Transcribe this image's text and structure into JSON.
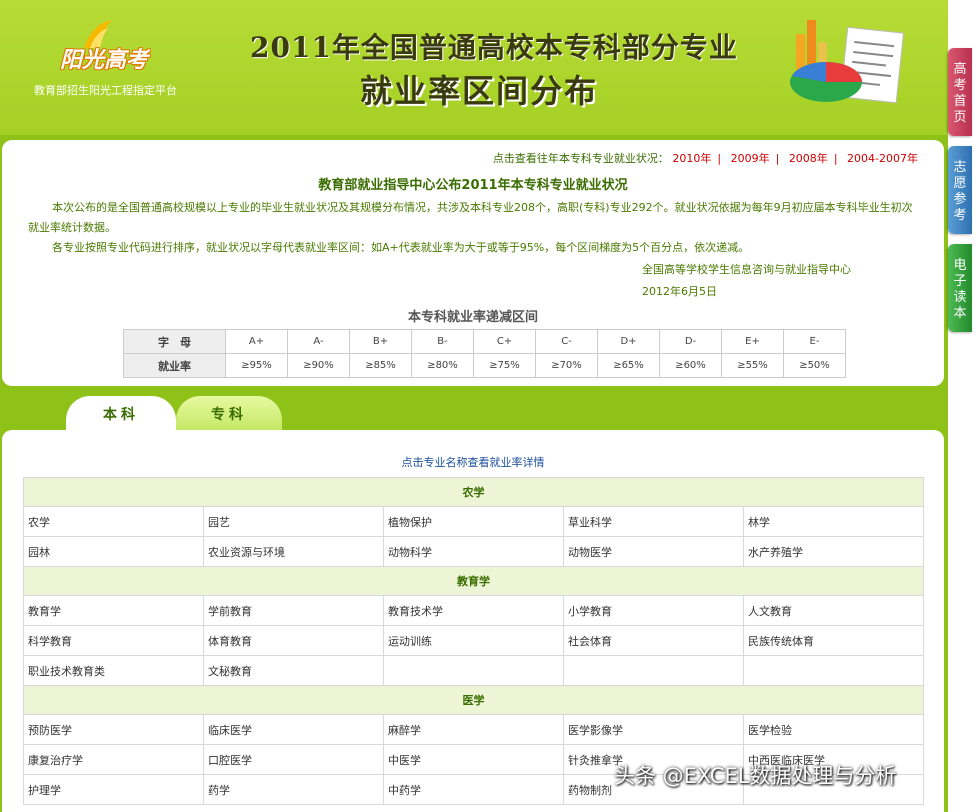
{
  "header": {
    "logo_text": "阳光高考",
    "logo_sub": "教育部招生阳光工程指定平台",
    "title_line1": "2011年全国普通高校本专科部分专业",
    "title_line2": "就业率区间分布"
  },
  "intro": {
    "past_label": "点击查看往年本专科专业就业状况：",
    "past_links": [
      "2010年",
      "2009年",
      "2008年",
      "2004-2007年"
    ],
    "title": "教育部就业指导中心公布2011年本专科专业就业状况",
    "para1": "本次公布的是全国普通高校规模以上专业的毕业生就业状况及其规模分布情况，共涉及本科专业208个，高职(专科)专业292个。就业状况依据为每年9月初应届本专科毕业生初次就业率统计数据。",
    "para2": "各专业按照专业代码进行排序，就业状况以字母代表就业率区间：如A+代表就业率为大于或等于95%，每个区间梯度为5个百分点，依次递减。",
    "sign_org": "全国高等学校学生信息咨询与就业指导中心",
    "sign_date": "2012年6月5日",
    "scale_title": "本专科就业率递减区间",
    "scale_head_letter": "字　母",
    "scale_head_rate": "就业率",
    "letters": [
      "A+",
      "A-",
      "B+",
      "B-",
      "C+",
      "C-",
      "D+",
      "D-",
      "E+",
      "E-"
    ],
    "rates": [
      "≥95%",
      "≥90%",
      "≥85%",
      "≥80%",
      "≥75%",
      "≥70%",
      "≥65%",
      "≥60%",
      "≥55%",
      "≥50%"
    ]
  },
  "tabs": {
    "ben": "本科",
    "zhuan": "专科"
  },
  "main": {
    "hint": "点击专业名称查看就业率详情",
    "categories": [
      {
        "name": "农学",
        "rows": [
          [
            "农学",
            "园艺",
            "植物保护",
            "草业科学",
            "林学"
          ],
          [
            "园林",
            "农业资源与环境",
            "动物科学",
            "动物医学",
            "水产养殖学"
          ]
        ]
      },
      {
        "name": "教育学",
        "rows": [
          [
            "教育学",
            "学前教育",
            "教育技术学",
            "小学教育",
            "人文教育"
          ],
          [
            "科学教育",
            "体育教育",
            "运动训练",
            "社会体育",
            "民族传统体育"
          ],
          [
            "职业技术教育类",
            "文秘教育",
            "",
            "",
            ""
          ]
        ]
      },
      {
        "name": "医学",
        "rows": [
          [
            "预防医学",
            "临床医学",
            "麻醉学",
            "医学影像学",
            "医学检验"
          ],
          [
            "康复治疗学",
            "口腔医学",
            "中医学",
            "针灸推拿学",
            "中西医临床医学"
          ],
          [
            "护理学",
            "药学",
            "中药学",
            "药物制剂",
            ""
          ]
        ]
      }
    ]
  },
  "side_tabs": [
    "高考首页",
    "志愿参考",
    "电子读本"
  ],
  "watermark": "头条 @EXCEL数据处理与分析",
  "colors": {
    "accent_green": "#8ec218",
    "link_red": "#cc0000",
    "link_blue": "#1a4f9a"
  }
}
